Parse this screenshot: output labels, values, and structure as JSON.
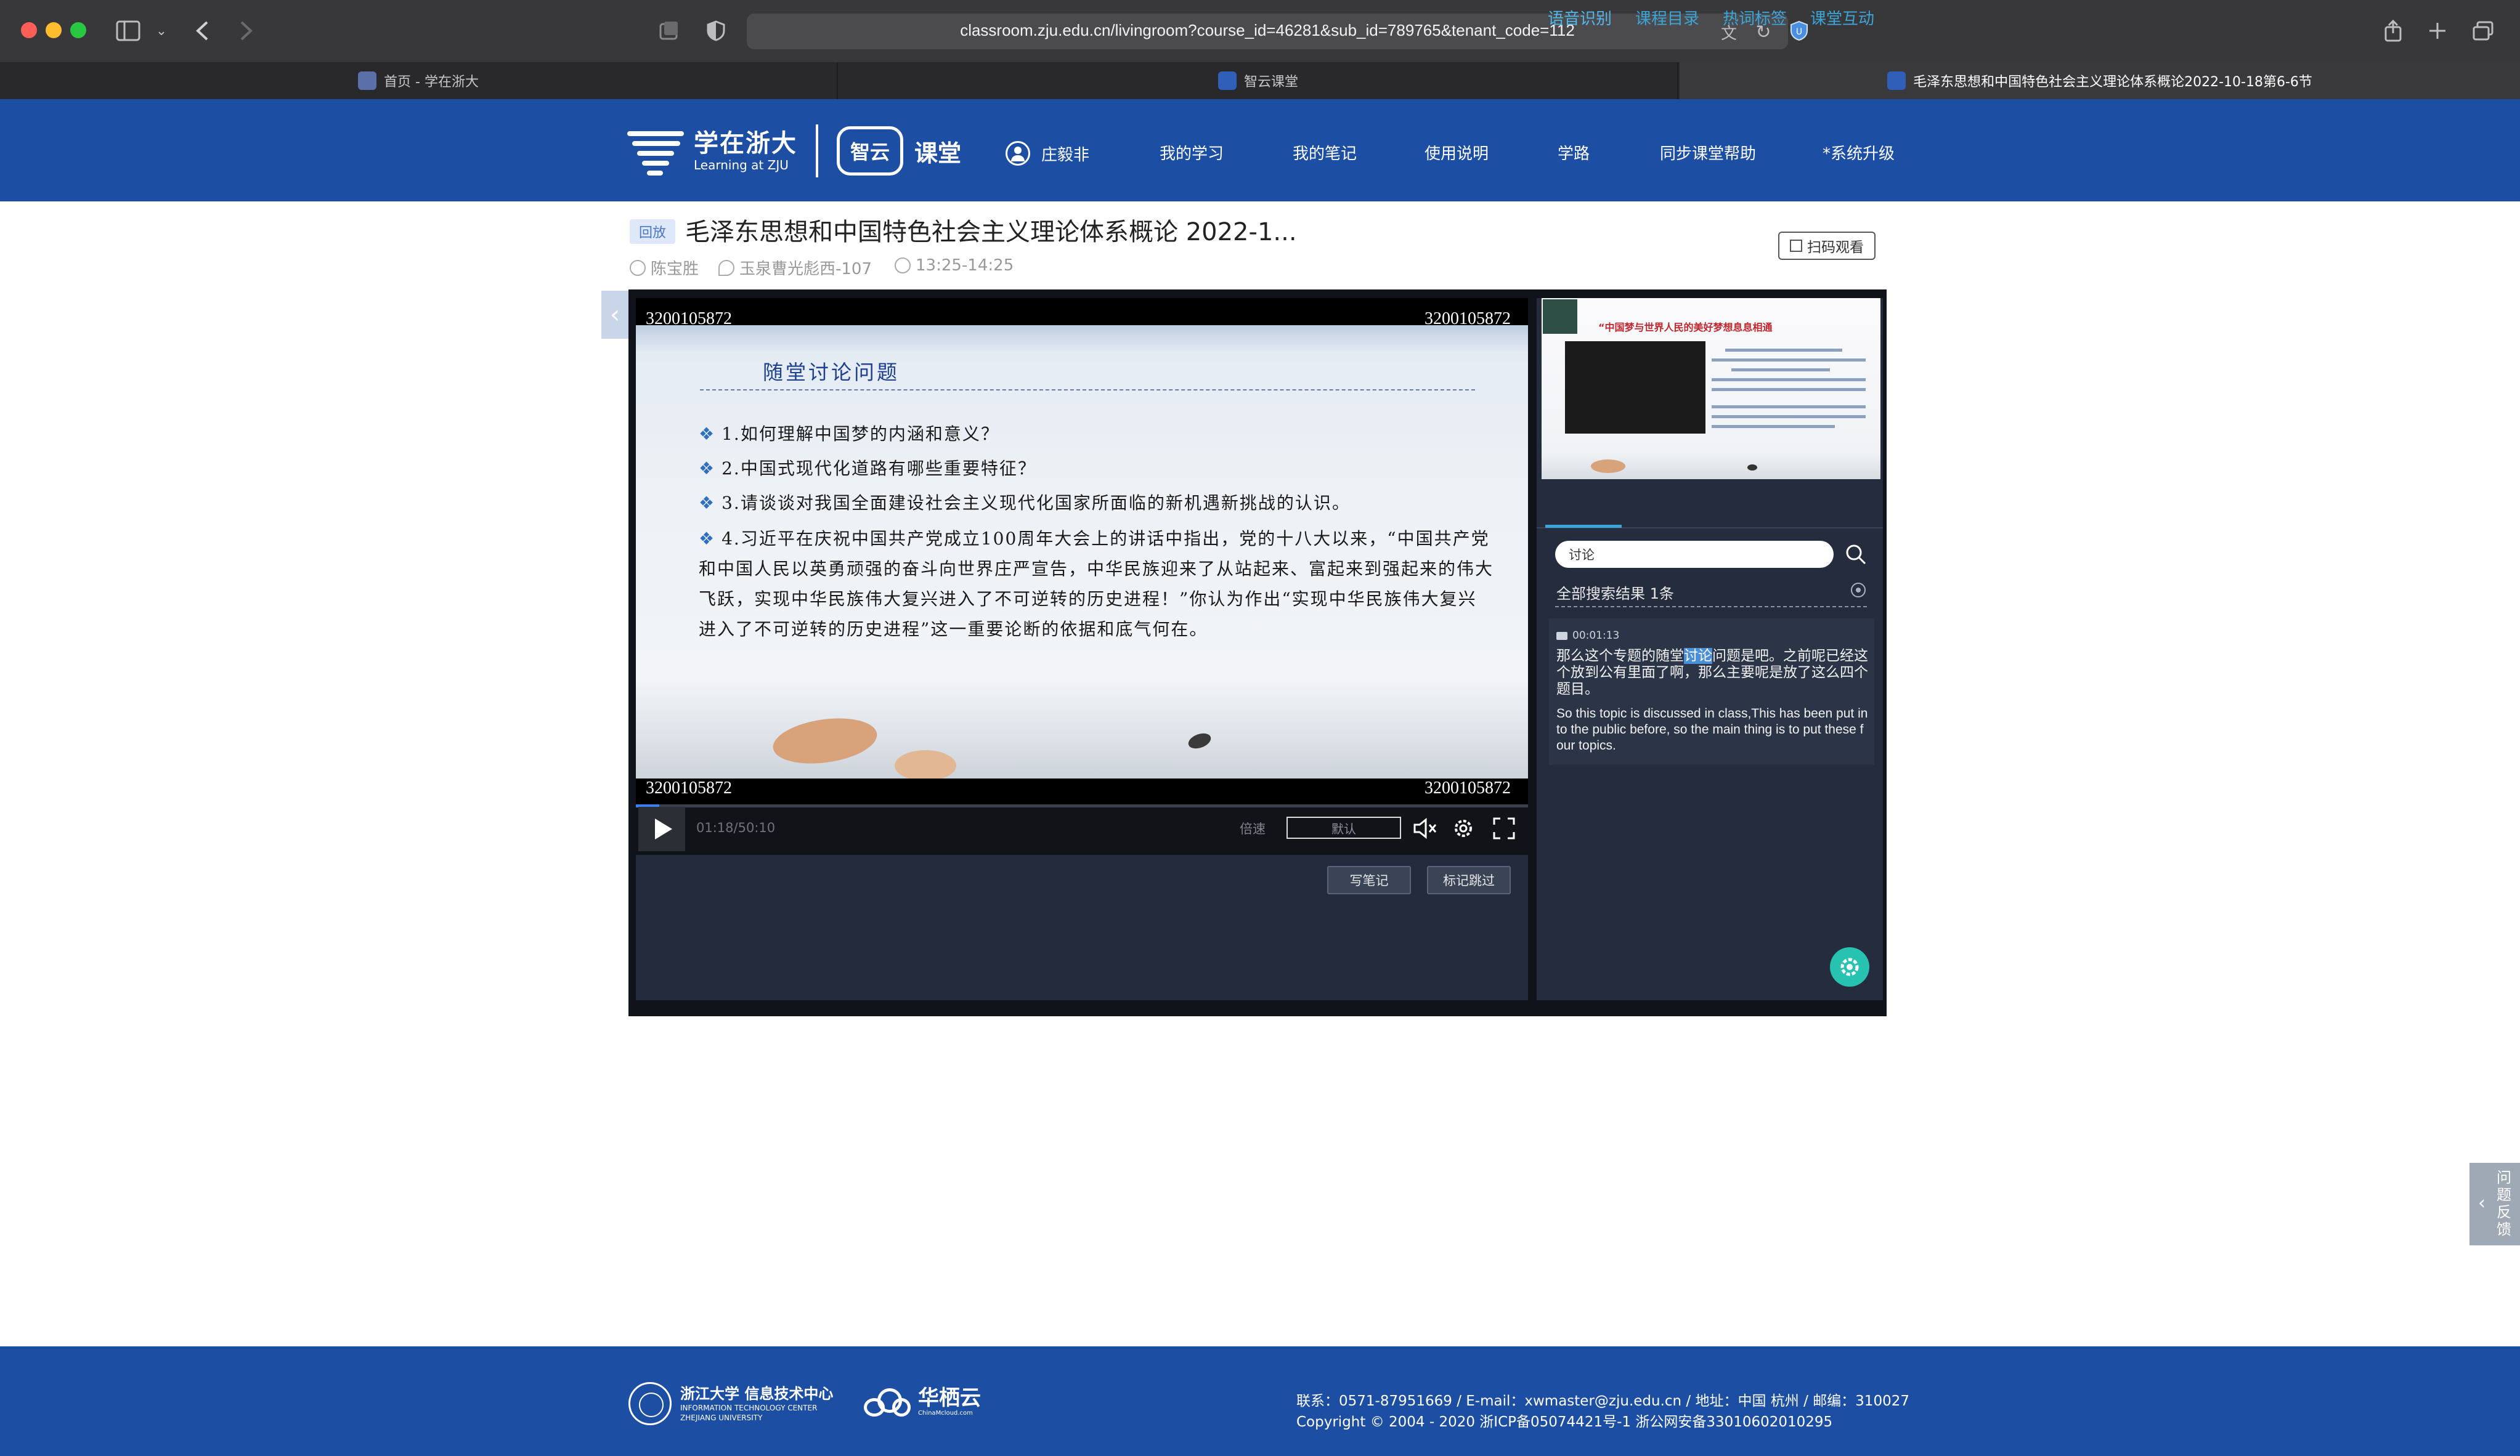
{
  "browser": {
    "url": "classroom.zju.edu.cn/livingroom?course_id=46281&sub_id=789765&tenant_code=112",
    "tabs": [
      {
        "label": "首页 - 学在浙大",
        "active": false
      },
      {
        "label": "智云课堂",
        "active": false
      },
      {
        "label": "毛泽东思想和中国特色社会主义理论体系概论2022-10-18第6-6节",
        "active": true
      }
    ]
  },
  "header": {
    "logo_zju_title": "学在浙大",
    "logo_zju_subtitle": "Learning at ZJU",
    "logo_zhiyun": "智云",
    "logo_ketang": "课堂",
    "user_name": "庄毅非",
    "nav": [
      "我的学习",
      "我的笔记",
      "使用说明",
      "学路",
      "同步课堂帮助",
      "*系统升级"
    ]
  },
  "course": {
    "badge": "回放",
    "title": "毛泽东思想和中国特色社会主义理论体系概论 2022-1...",
    "teacher": "陈宝胜",
    "room": "玉泉曹光彪西-107",
    "time": "13:25-14:25",
    "scan_button": "扫码观看"
  },
  "player": {
    "watermark": "3200105872",
    "slide": {
      "title": "随堂讨论问题",
      "items": [
        "1.如何理解中国梦的内涵和意义？",
        "2.中国式现代化道路有哪些重要特征？",
        "3.请谈谈对我国全面建设社会主义现代化国家所面临的新机遇新挑战的认识。"
      ],
      "item4": "4.习近平在庆祝中国共产党成立100周年大会上的讲话中指出，党的十八大以来，“中国共产党和中国人民以英勇顽强的奋斗向世界庄严宣告，中华民族迎来了从站起来、富起来到强起来的伟大飞跃，实现中华民族伟大复兴进入了不可逆转的历史进程！”你认为作出“实现中华民族伟大复兴进入了不可逆转的历史进程”这一重要论断的依据和底气何在。"
    },
    "time_display": "01:18/50:10",
    "progress_fraction": 0.026,
    "speed_label": "倍速",
    "speed_value": "默认",
    "write_note_button": "写笔记",
    "mark_skip_button": "标记跳过"
  },
  "panel": {
    "thumb_title": "“中国梦与世界人民的美好梦想息息相通",
    "tabs": [
      "语音识别",
      "课程目录",
      "热词标签",
      "课堂互动"
    ],
    "search_value": "讨论",
    "result_prefix": "全部搜索结果 ",
    "result_count": "1",
    "result_suffix": "条",
    "result": {
      "timestamp": "00:01:13",
      "zh_before": "那么这个专题的随堂",
      "zh_highlight": "讨论",
      "zh_after": "问题是吧。之前呢已经这个放到公有里面了啊，那么主要呢是放了这么四个题目。",
      "en": "So this topic is discussed in class,This has been put into the public before, so the main thing is to put these four topics."
    }
  },
  "feedback": {
    "label": "问题反馈"
  },
  "footer": {
    "itc_name": "浙江大学 信息技术中心",
    "itc_english": "INFORMATION TECHNOLOGY CENTER",
    "itc_university": "ZHEJIANG UNIVERSITY",
    "partner_name": "华栖云",
    "partner_sub": "ChinaMcloud.com",
    "contact_line": "联系：0571-87951669 / E-mail：xwmaster@zju.edu.cn / 地址：中国 杭州 / 邮编：310027",
    "copyright_line": "Copyright © 2004 - 2020 浙ICP备05074421号-1 浙公网安备33010602010295"
  },
  "colors": {
    "brand_blue": "#1c4ea3",
    "panel_accent": "#3da4d8",
    "fab_teal": "#27c3b0"
  }
}
